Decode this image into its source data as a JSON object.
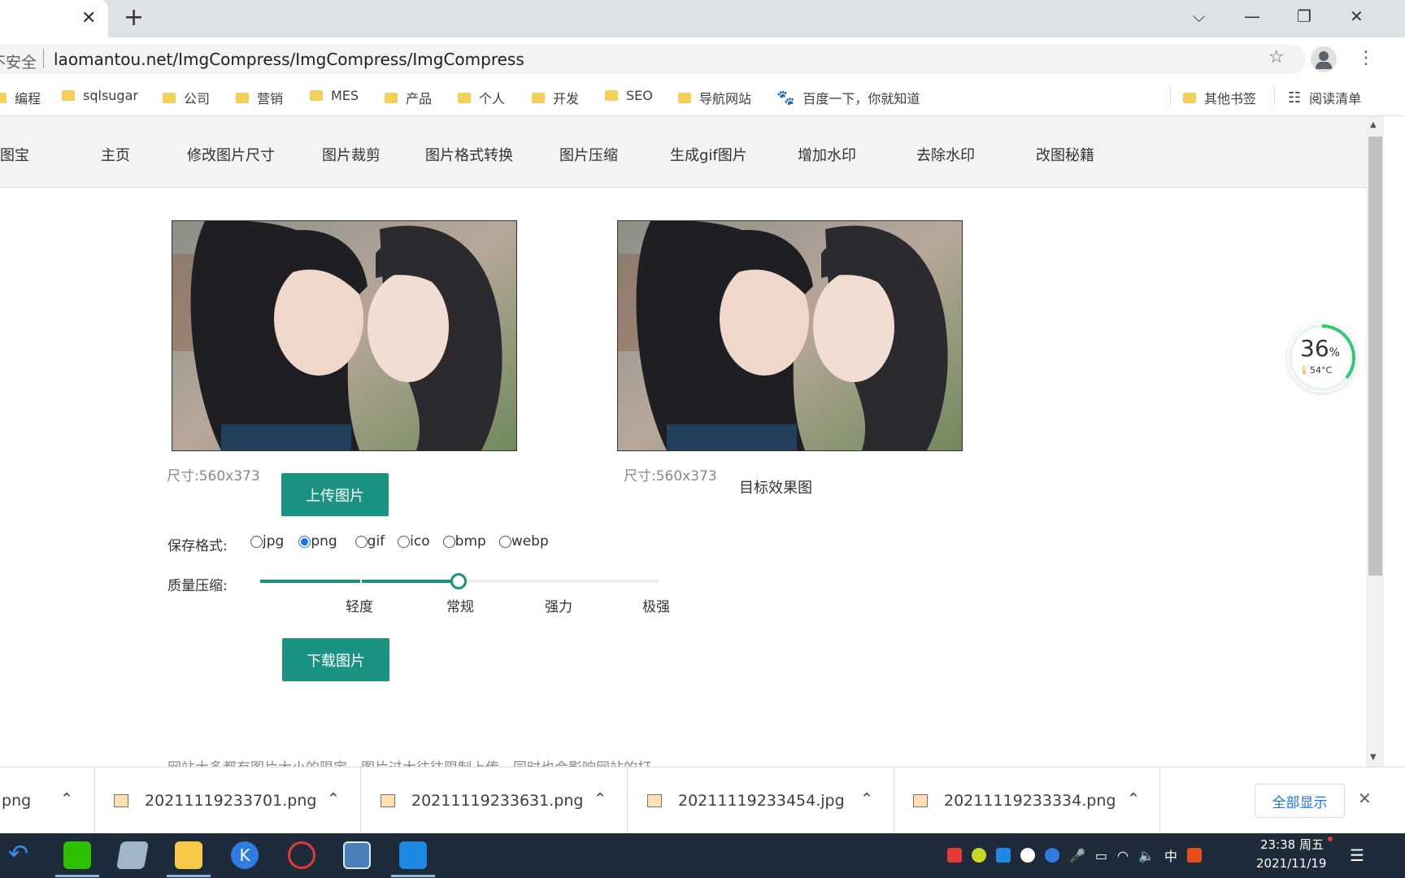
{
  "browser": {
    "tab_close": "✕",
    "new_tab": "+",
    "security": "不安全",
    "url": "laomantou.net/ImgCompress/ImgCompress/ImgCompress",
    "window_controls": {
      "dropdown": "⌵",
      "minimize": "—",
      "maximize": "❐",
      "close": "✕"
    }
  },
  "bookmarks": {
    "items": [
      "编程",
      "sqlsugar",
      "公司",
      "营销",
      "MES",
      "产品",
      "个人",
      "开发",
      "SEO",
      "导航网站",
      "百度一下，你就知道"
    ],
    "other": "其他书签",
    "reading_list": "阅读清单"
  },
  "site_nav": {
    "brand": "修图宝",
    "items": [
      "主页",
      "修改图片尺寸",
      "图片裁剪",
      "图片格式转换",
      "图片压缩",
      "生成gif图片",
      "增加水印",
      "去除水印",
      "改图秘籍"
    ]
  },
  "editor": {
    "source_size": "尺寸:560x373",
    "target_size": "尺寸:560x373",
    "target_caption": "目标效果图",
    "upload_button": "上传图片",
    "format_label": "保存格式:",
    "formats": [
      "jpg",
      "png",
      "gif",
      "ico",
      "bmp",
      "webp"
    ],
    "selected_format": "png",
    "quality_label": "质量压缩:",
    "quality_levels": [
      "轻度",
      "常规",
      "强力",
      "极强"
    ],
    "quality_value": "常规",
    "download_button": "下载图片",
    "footer_text": "网站大多都有图片大小的限定，图片过大往往限制上传，同时也会影响网站的打"
  },
  "monitor": {
    "percent": "36",
    "percent_sign": "%",
    "temp": "54°C"
  },
  "downloads": {
    "items": [
      ".png",
      "20211119233701.png",
      "20211119233631.png",
      "20211119233454.jpg",
      "20211119233334.png"
    ],
    "show_all": "全部显示",
    "close": "✕"
  },
  "taskbar": {
    "ime": "中",
    "time": "23:38 周五",
    "date": "2021/11/19"
  },
  "colors": {
    "accent": "#1a9382",
    "taskbar": "#1e2b3a"
  }
}
